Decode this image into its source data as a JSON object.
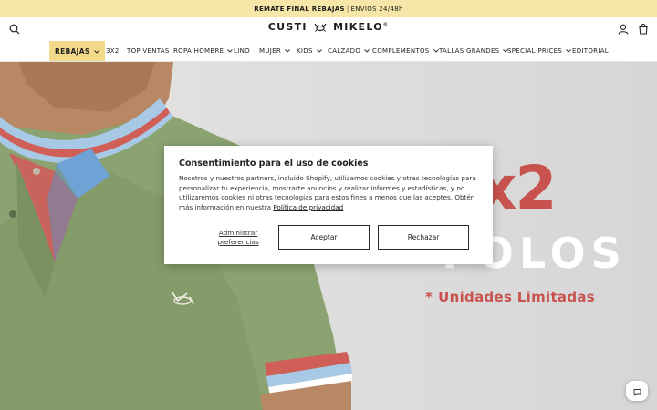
{
  "announcement": {
    "highlight": "REMATE FINAL REBAJAS",
    "separator": "|",
    "text": "ENVÍOS 24/48h"
  },
  "header": {
    "logo_left": "CUSTI",
    "logo_right": "MIKELO",
    "logo_reg": "®",
    "icons": [
      "search-icon",
      "user-icon",
      "cart-icon"
    ]
  },
  "nav": {
    "items": [
      {
        "label": "REBAJAS",
        "dropdown": true,
        "active": true
      },
      {
        "label": "3X2",
        "dropdown": false
      },
      {
        "label": "TOP VENTAS",
        "dropdown": false
      },
      {
        "label": "ROPA HOMBRE",
        "dropdown": true
      },
      {
        "label": "LINO",
        "dropdown": false
      },
      {
        "label": "MUJER",
        "dropdown": true
      },
      {
        "label": "KIDS",
        "dropdown": true
      },
      {
        "label": "CALZADO",
        "dropdown": true
      },
      {
        "label": "COMPLEMENTOS",
        "dropdown": true
      },
      {
        "label": "TALLAS GRANDES",
        "dropdown": true
      },
      {
        "label": "SPECIAL PRICES",
        "dropdown": true
      },
      {
        "label": "EDITORIAL",
        "dropdown": false
      }
    ]
  },
  "hero": {
    "promo_big": "3x2",
    "promo_product": "POLOS",
    "promo_note_mark": "*",
    "promo_note": "Unidades Limitadas"
  },
  "cookie_dialog": {
    "title": "Consentimiento para el uso de cookies",
    "body": "Nosotros y nuestros partners, incluido Shopify, utilizamos cookies y otras tecnologías para personalizar tu experiencia, mostrarte anuncios y realizar informes y estadísticas, y no utilizaremos cookies ni otras tecnologías para estos fines a menos que las aceptes. Obtén más información en nuestra",
    "privacy_link": "Política de privacidad",
    "manage_label": "Administrar preferencias",
    "accept_label": "Aceptar",
    "reject_label": "Rechazar"
  },
  "colors": {
    "announcement_bg": "#f6e7a8",
    "nav_active_bg": "#f3d98a",
    "promo_red": "#c8534e",
    "polo_green": "#8aa370"
  }
}
